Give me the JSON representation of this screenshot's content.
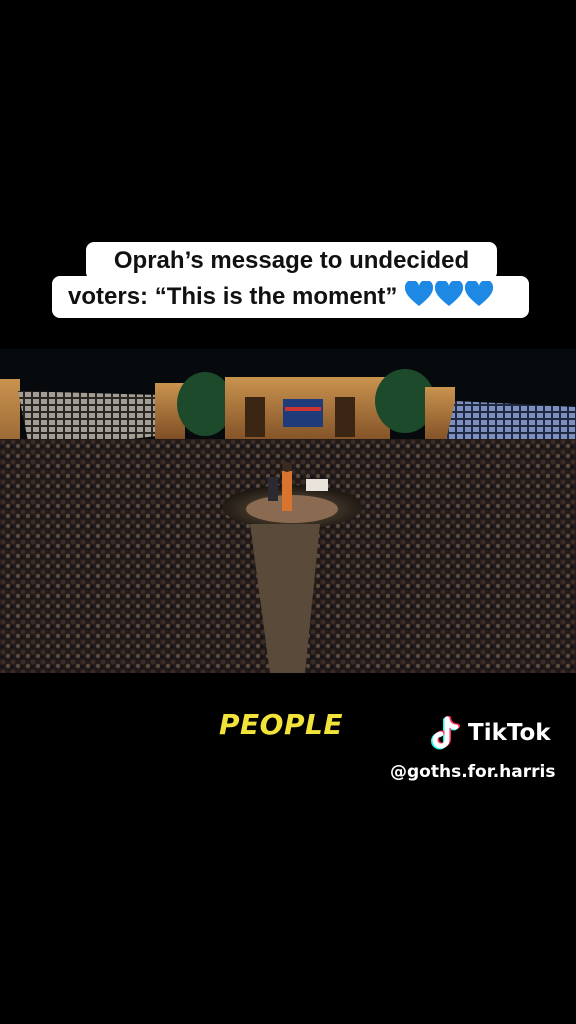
{
  "caption": {
    "line1": "Oprah’s message to undecided",
    "line2": "voters: “This is the moment”",
    "emoji": [
      "blue-heart",
      "blue-heart",
      "blue-heart"
    ]
  },
  "subtitle": "PEOPLE",
  "watermark": {
    "brand": "TikTok",
    "handle": "@goths.for.harris"
  },
  "colors": {
    "subtitle": "#f2e33a",
    "heart": "#1e88e5",
    "caption_bg": "#ffffff"
  }
}
